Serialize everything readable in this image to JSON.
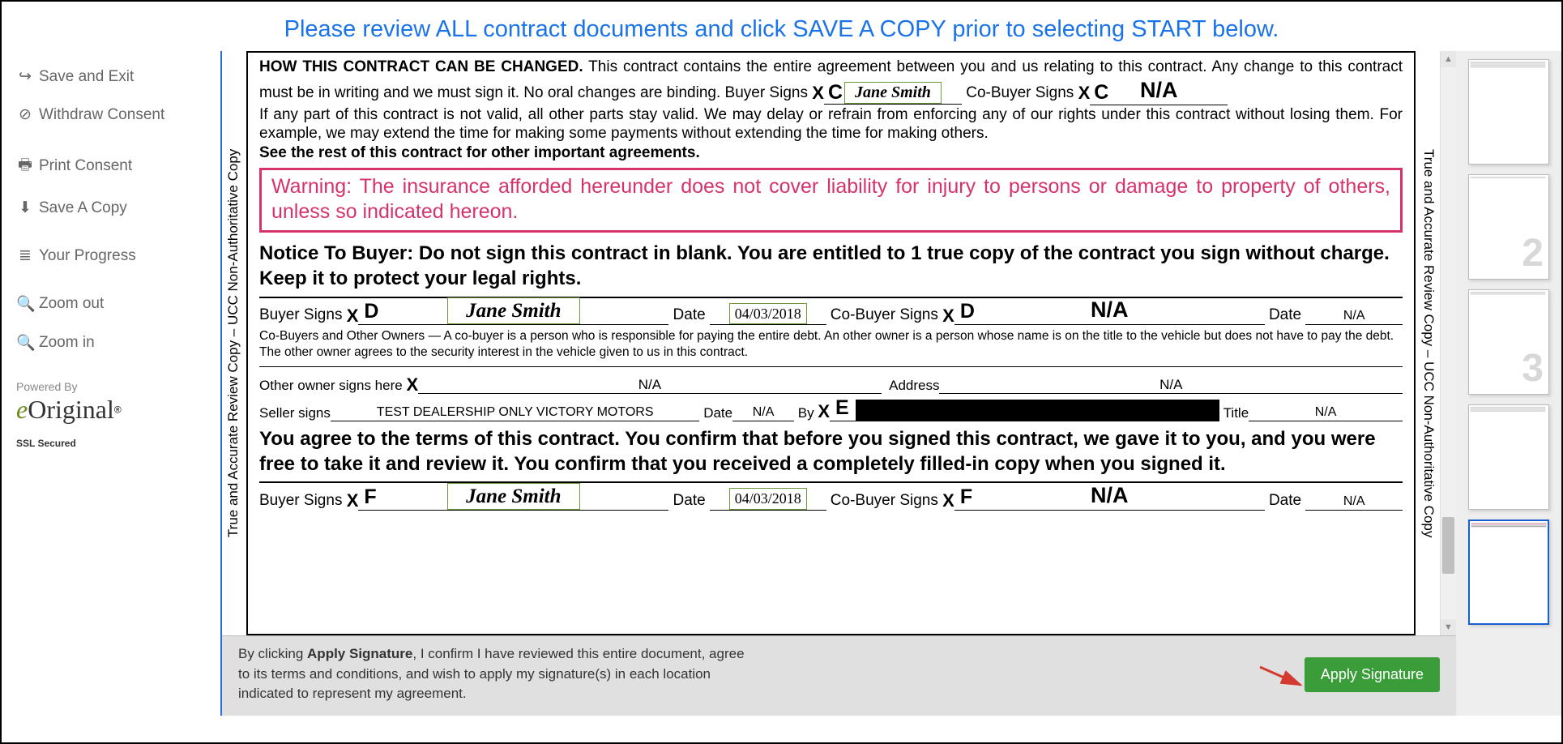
{
  "banner": "Please review ALL contract documents and click SAVE A COPY prior to selecting START below.",
  "sidebar": {
    "items": [
      {
        "icon": "↪",
        "label": "Save and Exit"
      },
      {
        "icon": "⊘",
        "label": "Withdraw Consent"
      },
      {
        "icon": "🖶",
        "label": "Print Consent"
      },
      {
        "icon": "⬇",
        "label": "Save A Copy"
      },
      {
        "icon": "≣",
        "label": "Your Progress"
      },
      {
        "icon": "⚲",
        "label": "Zoom out"
      },
      {
        "icon": "⚲",
        "label": "Zoom in"
      }
    ],
    "powered": "Powered By",
    "logo": "eOriginal",
    "ssl": "SSL Secured"
  },
  "doc": {
    "side_text": "True and Accurate Review Copy – UCC Non-Authoritative Copy",
    "heading": "HOW THIS CONTRACT CAN BE CHANGED.",
    "para1a": " This contract contains the entire agreement between you and us relating to this contract. Any change to this contract must be in writing and we must sign it. No oral changes are binding.  Buyer Signs ",
    "inline_sig_c_buyer": {
      "x": "X",
      "letter": "C",
      "sig": "Jane Smith"
    },
    "para1b": "  Co-Buyer Signs ",
    "inline_sig_c_cobuyer": {
      "x": "X",
      "letter": "C",
      "na": "N/A"
    },
    "para2": "If any part of this contract is not valid, all other parts stay valid. We may delay or refrain from enforcing any of our rights under this contract without losing them. For example, we may extend the time for making some payments without extending the time for making others.",
    "see_rest": "See the rest of this contract for other important agreements.",
    "warning": "Warning: The insurance afforded hereunder does not cover liability for injury to persons or damage to property of others, unless so indicated hereon.",
    "notice": "Notice To Buyer: Do not sign this contract in blank. You are entitled to 1 true copy of the contract you sign without charge. Keep it to protect your legal rights.",
    "sig_d": {
      "buyer_lbl": "Buyer Signs",
      "x": "X",
      "letter": "D",
      "sig": "Jane Smith",
      "date_lbl": "Date",
      "date": "04/03/2018",
      "co_lbl": "Co-Buyer Signs",
      "co_letter": "D",
      "co_na": "N/A",
      "co_date_lbl": "Date",
      "co_date": "N/A"
    },
    "cobuyer_note": "Co-Buyers and Other Owners — A co-buyer is a person who is responsible for paying the entire debt. An other owner is a person whose name is on the title to the vehicle but does not have to pay the debt. The other owner agrees to the security interest in the vehicle given to us in this contract.",
    "other_owner": {
      "lbl": "Other owner signs here",
      "x": "X",
      "val": "N/A",
      "addr_lbl": "Address",
      "addr": "N/A"
    },
    "seller": {
      "lbl": "Seller signs",
      "val": "TEST DEALERSHIP ONLY VICTORY MOTORS",
      "date_lbl": "Date",
      "date": "N/A",
      "by_lbl": "By",
      "x": "X",
      "letter": "E",
      "title_lbl": "Title",
      "title": "N/A"
    },
    "agree": "You agree to the terms of this contract. You confirm that before you signed this contract, we gave it to you, and you were free to take it and review it. You confirm that you received a completely filled-in copy when you signed it.",
    "sig_f": {
      "buyer_lbl": "Buyer Signs",
      "x": "X",
      "letter": "F",
      "sig": "Jane Smith",
      "date_lbl": "Date",
      "date": "04/03/2018",
      "co_lbl": "Co-Buyer Signs",
      "co_letter": "F",
      "co_na": "N/A",
      "co_date_lbl": "Date",
      "co_date": "N/A"
    }
  },
  "footer": {
    "text_pre": "By clicking ",
    "text_bold": "Apply Signature",
    "text_post": ", I confirm I have reviewed this entire document, agree to its terms and conditions, and wish to apply my signature(s) in each location indicated to represent my agreement.",
    "button": "Apply Signature"
  },
  "thumbs": {
    "count": 5,
    "active": 5
  }
}
